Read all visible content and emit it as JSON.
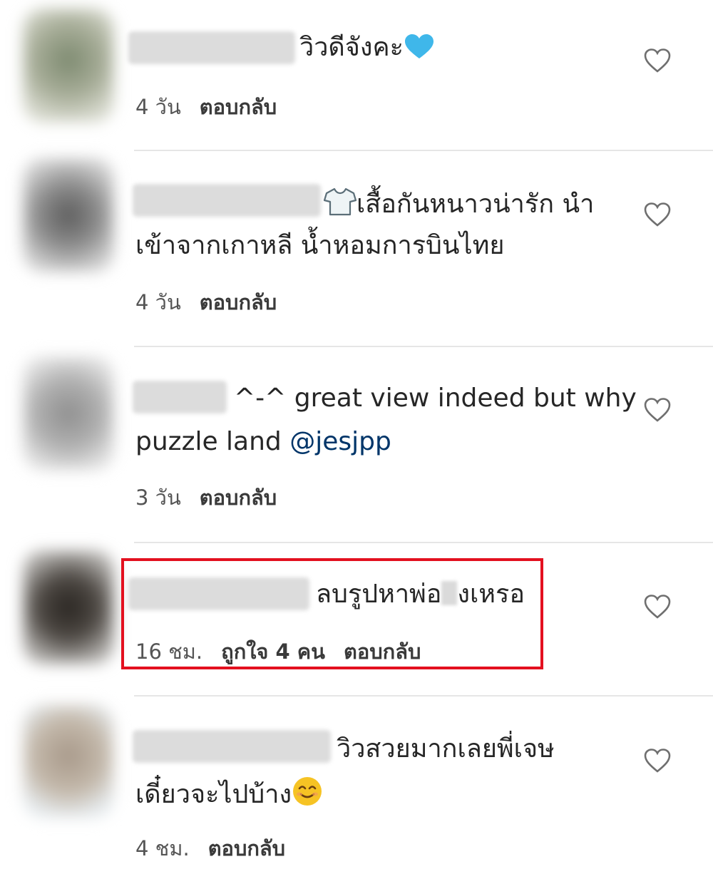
{
  "colors": {
    "text": "#262626",
    "secondary_text": "#8e8e8e",
    "mention": "#003569",
    "highlight_border": "#e3101f",
    "divider": "#e6e6e6",
    "heart_emoji": "#3fb7ea"
  },
  "comments": [
    {
      "text_line1": "วิวดีจังคะ",
      "emoji": "blue-heart",
      "time": "4 วัน",
      "reply_label": "ตอบกลับ"
    },
    {
      "emoji": "t-shirt",
      "text_line1": "เสื้อกันหนาวน่ารัก นำ",
      "text_line2": "เข้าจากเกาหลี น้ำหอมการบินไทย",
      "time": "4 วัน",
      "reply_label": "ตอบกลับ"
    },
    {
      "text_line1": "^-^ great view indeed but why",
      "text_line2_prefix": "puzzle land ",
      "mention": "@jesjpp",
      "time": "3 วัน",
      "reply_label": "ตอบกลับ"
    },
    {
      "text_part1": "ลบรูปหาพ่อ",
      "text_part2": "งเหรอ",
      "time": "16 ชม.",
      "likes_label": "ถูกใจ 4 คน",
      "reply_label": "ตอบกลับ"
    },
    {
      "text_line1": "วิวสวยมากเลยพี่เจษ",
      "text_line2": "เดี๋ยวจะไปบ้าง",
      "emoji": "smiling-face",
      "time": "4 ชม.",
      "reply_label": "ตอบกลับ"
    }
  ]
}
